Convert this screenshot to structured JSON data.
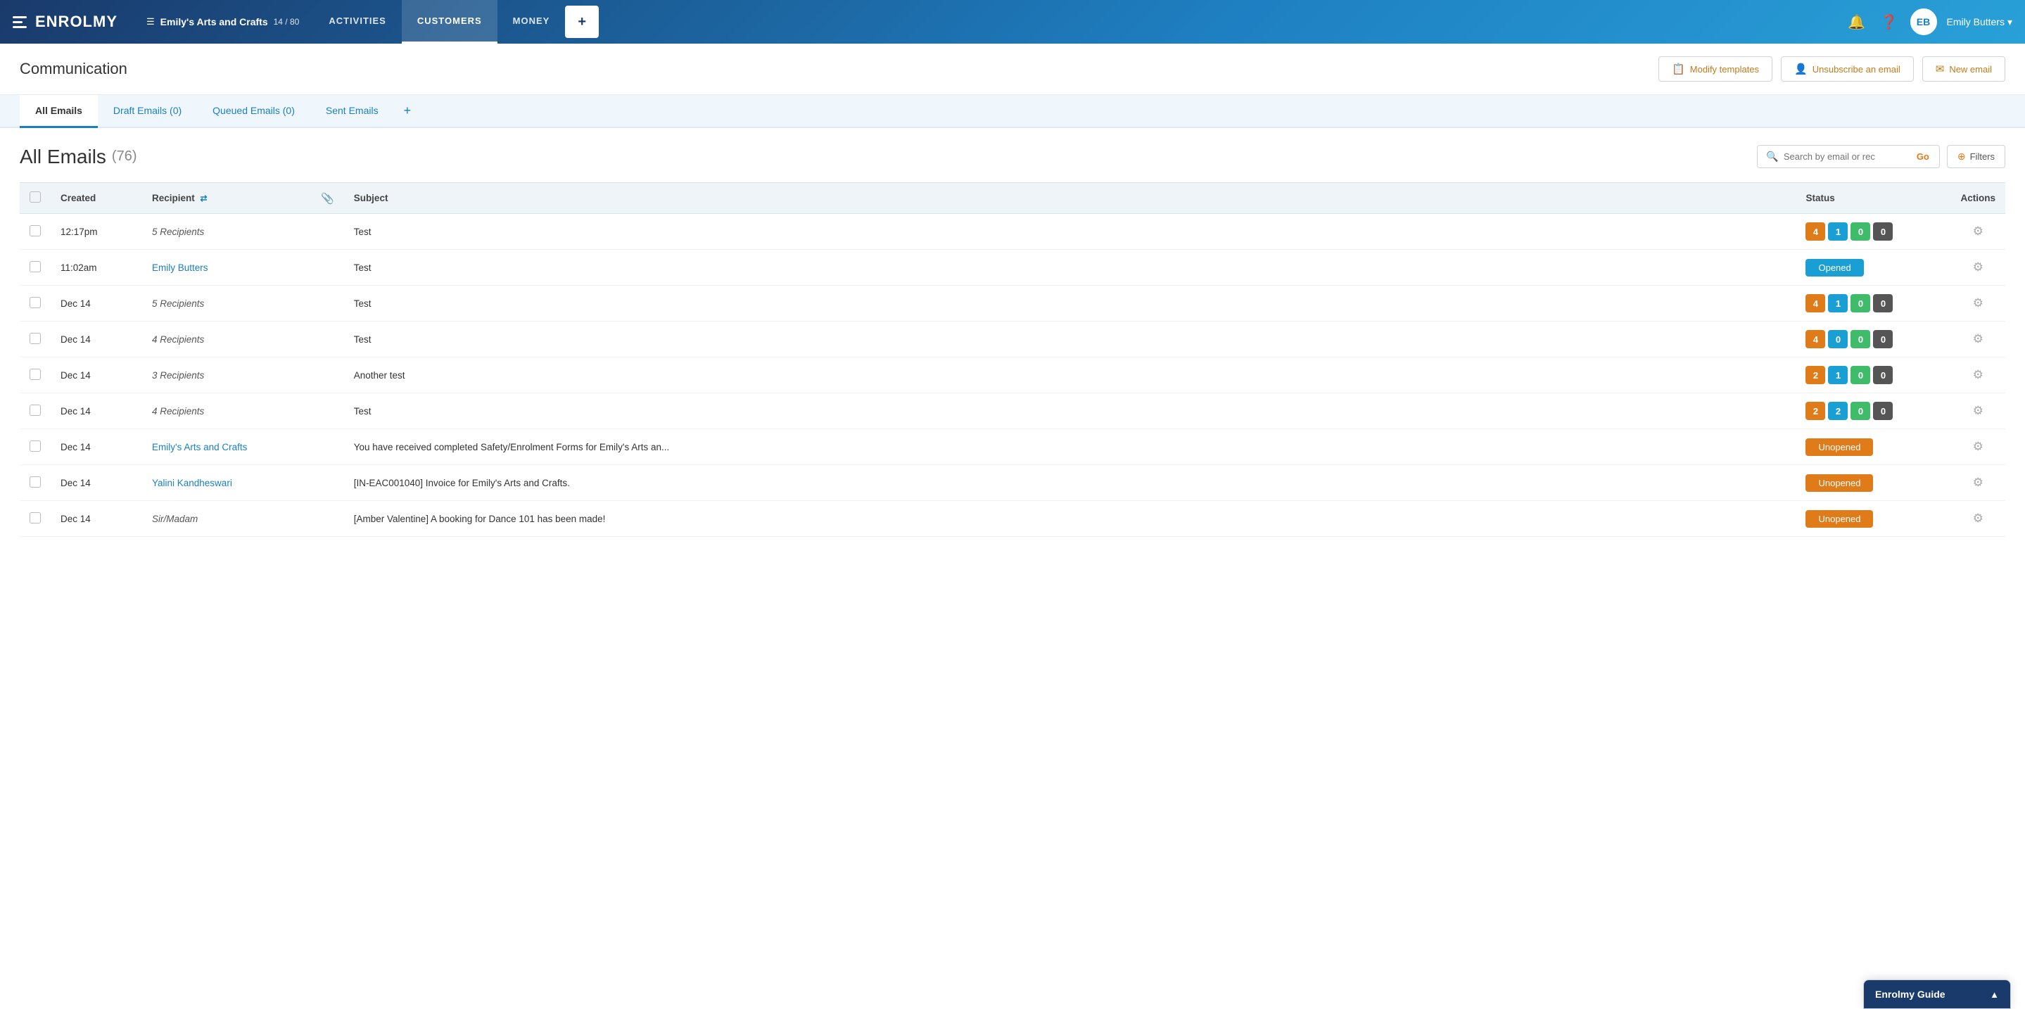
{
  "header": {
    "logo_text": "ENROLMY",
    "org_name": "Emily's Arts and Crafts",
    "org_count": "14 / 80",
    "nav_items": [
      {
        "label": "ACTIVITIES",
        "active": false
      },
      {
        "label": "CUSTOMERS",
        "active": true
      },
      {
        "label": "MONEY",
        "active": false
      }
    ],
    "nav_plus": "+",
    "user_initials": "EB",
    "user_name": "Emily Butters",
    "user_chevron": "▾"
  },
  "page": {
    "title": "Communication",
    "actions": [
      {
        "label": "Modify templates",
        "icon": "📋"
      },
      {
        "label": "Unsubscribe an email",
        "icon": "👤"
      },
      {
        "label": "New email",
        "icon": "✉"
      }
    ]
  },
  "sub_tabs": [
    {
      "label": "All Emails",
      "active": true
    },
    {
      "label": "Draft Emails (0)",
      "active": false
    },
    {
      "label": "Queued Emails (0)",
      "active": false
    },
    {
      "label": "Sent Emails",
      "active": false
    }
  ],
  "emails_section": {
    "title": "All Emails",
    "count": "(76)",
    "search_placeholder": "Search by email or rec",
    "go_label": "Go",
    "filters_label": "Filters"
  },
  "table": {
    "columns": [
      {
        "label": ""
      },
      {
        "label": "Created"
      },
      {
        "label": "Recipient"
      },
      {
        "label": ""
      },
      {
        "label": "Subject"
      },
      {
        "label": ""
      },
      {
        "label": "Status"
      },
      {
        "label": "Actions"
      }
    ],
    "rows": [
      {
        "created": "12:17pm",
        "recipient": "5 Recipients",
        "recipient_link": false,
        "subject": "Test",
        "status_type": "badges",
        "badges": [
          {
            "val": "4",
            "type": "orange"
          },
          {
            "val": "1",
            "type": "blue"
          },
          {
            "val": "0",
            "type": "green"
          },
          {
            "val": "0",
            "type": "dark"
          }
        ]
      },
      {
        "created": "11:02am",
        "recipient": "Emily Butters",
        "recipient_link": true,
        "subject": "Test",
        "status_type": "opened",
        "status_label": "Opened"
      },
      {
        "created": "Dec 14",
        "recipient": "5 Recipients",
        "recipient_link": false,
        "subject": "Test",
        "status_type": "badges",
        "badges": [
          {
            "val": "4",
            "type": "orange"
          },
          {
            "val": "1",
            "type": "blue"
          },
          {
            "val": "0",
            "type": "green"
          },
          {
            "val": "0",
            "type": "dark"
          }
        ]
      },
      {
        "created": "Dec 14",
        "recipient": "4 Recipients",
        "recipient_link": false,
        "subject": "Test",
        "status_type": "badges",
        "badges": [
          {
            "val": "4",
            "type": "orange"
          },
          {
            "val": "0",
            "type": "blue"
          },
          {
            "val": "0",
            "type": "green"
          },
          {
            "val": "0",
            "type": "dark"
          }
        ]
      },
      {
        "created": "Dec 14",
        "recipient": "3 Recipients",
        "recipient_link": false,
        "subject": "Another test",
        "status_type": "badges",
        "badges": [
          {
            "val": "2",
            "type": "orange"
          },
          {
            "val": "1",
            "type": "blue"
          },
          {
            "val": "0",
            "type": "green"
          },
          {
            "val": "0",
            "type": "dark"
          }
        ]
      },
      {
        "created": "Dec 14",
        "recipient": "4 Recipients",
        "recipient_link": false,
        "subject": "Test",
        "status_type": "badges",
        "badges": [
          {
            "val": "2",
            "type": "orange"
          },
          {
            "val": "2",
            "type": "blue"
          },
          {
            "val": "0",
            "type": "green"
          },
          {
            "val": "0",
            "type": "dark"
          }
        ]
      },
      {
        "created": "Dec 14",
        "recipient": "Emily's Arts and Crafts",
        "recipient_link": true,
        "subject": "You have received completed Safety/Enrolment Forms for Emily's Arts an...",
        "status_type": "unopened",
        "status_label": "Unopened"
      },
      {
        "created": "Dec 14",
        "recipient": "Yalini Kandheswari",
        "recipient_link": true,
        "subject": "[IN-EAC001040] Invoice for Emily's Arts and Crafts.",
        "status_type": "unopened",
        "status_label": "Unopened"
      },
      {
        "created": "Dec 14",
        "recipient": "Sir/Madam",
        "recipient_link": false,
        "subject": "[Amber Valentine] A booking for Dance 101 has been made!",
        "status_type": "unopened",
        "status_label": "Unopened"
      }
    ]
  },
  "guide_popup": {
    "title": "Enrolmy Guide",
    "chevron": "▲"
  }
}
